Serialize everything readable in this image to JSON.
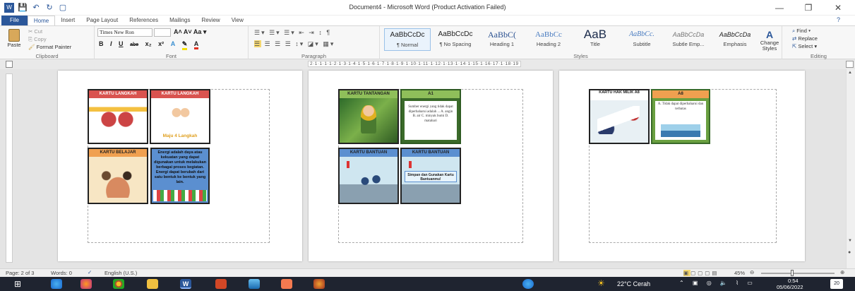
{
  "window": {
    "title": "Document4  -  Microsoft Word (Product Activation Failed)",
    "minimize": "—",
    "restore": "❐",
    "close": "✕"
  },
  "qat": {
    "save": "💾",
    "undo": "↶",
    "redo": "↻",
    "new": "▢"
  },
  "tabs": [
    "File",
    "Home",
    "Insert",
    "Page Layout",
    "References",
    "Mailings",
    "Review",
    "View"
  ],
  "ribbon": {
    "clipboard": {
      "paste": "Paste",
      "cut": "Cut",
      "copy": "Copy",
      "format_painter": "Format Painter",
      "label": "Clipboard"
    },
    "font": {
      "name": "Times New Ron",
      "size": "",
      "label": "Font",
      "buttons": [
        "B",
        "I",
        "U",
        "abe",
        "x₂",
        "x²"
      ]
    },
    "paragraph": {
      "label": "Paragraph"
    },
    "styles": {
      "label": "Styles",
      "items": [
        {
          "preview": "AaBbCcDc",
          "name": "¶ Normal"
        },
        {
          "preview": "AaBbCcDc",
          "name": "¶ No Spacing"
        },
        {
          "preview": "AaBbC(",
          "name": "Heading 1"
        },
        {
          "preview": "AaBbCc",
          "name": "Heading 2"
        },
        {
          "preview": "AaB",
          "name": "Title"
        },
        {
          "preview": "AaBbCc.",
          "name": "Subtitle"
        },
        {
          "preview": "AaBbCcDa",
          "name": "Subtle Emp..."
        },
        {
          "preview": "AaBbCcDa",
          "name": "Emphasis"
        }
      ],
      "change_styles": "Change Styles"
    },
    "editing": {
      "find": "Find",
      "replace": "Replace",
      "select": "Select",
      "label": "Editing"
    }
  },
  "ruler": {
    "marks": "2·1·1·1·1·2·1·3·1·4·1·5·1·6·1·7·1·8·1·9·1·10·1·11·1·12·1·13·1·14·1·15·1·16·17·1·18·19"
  },
  "pages": [
    {
      "cards": [
        {
          "header": "KARTU LANGKAH",
          "text": ""
        },
        {
          "header": "KARTU LANGKAH",
          "text": "Maju 4 Langkah"
        },
        {
          "header": "KARTU BELAJAR",
          "text": ""
        },
        {
          "header": "",
          "text": "Energi adalah daya atau kekuatan yang dapat digunakan untuk melakukan berbagai proses kegiatan. Energi dapat berubah dari satu bentuk ke bentuk yang lain."
        }
      ]
    },
    {
      "cards": [
        {
          "header": "KARTU TANTANGAN",
          "text": ""
        },
        {
          "header": "A1",
          "text": "Sumber energi yang tidak dapat diperbaharui adalah ... A. angin B. air C. minyak bumi D. matahari"
        },
        {
          "header": "KARTU BANTUAN",
          "text": ""
        },
        {
          "header": "KARTU BANTUAN",
          "text": "Simpan dan Gunakan Kartu Bantuanmu!"
        }
      ]
    },
    {
      "cards": [
        {
          "header": "KARTU HAK MILIK A8",
          "text": ""
        },
        {
          "header": "A8",
          "text": "A. Tidak dapat diperbaharui dan terbatas"
        }
      ]
    }
  ],
  "status": {
    "page": "Page: 2 of 3",
    "words": "Words: 0",
    "language": "English (U.S.)",
    "zoom": "45%"
  },
  "taskbar": {
    "weather": "22°C  Cerah",
    "time": "0:54",
    "date": "05/06/2022",
    "notif": "20"
  },
  "colors": {
    "word_blue": "#2b579a",
    "card_red": "#d9534f",
    "card_green": "#8fbf5a",
    "card_orange": "#f0a050",
    "card_blue": "#5b8fd0"
  }
}
